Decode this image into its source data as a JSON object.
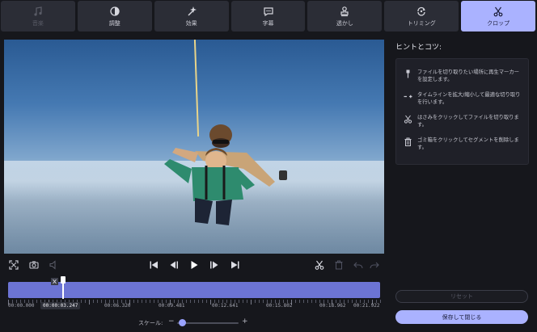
{
  "tabs": [
    {
      "label": "音楽",
      "icon": "music-note-icon",
      "state": "disabled"
    },
    {
      "label": "調整",
      "icon": "adjust-icon",
      "state": "normal"
    },
    {
      "label": "効果",
      "icon": "magic-wand-icon",
      "state": "normal"
    },
    {
      "label": "字幕",
      "icon": "speech-bubble-icon",
      "state": "normal"
    },
    {
      "label": "透かし",
      "icon": "stamp-icon",
      "state": "normal"
    },
    {
      "label": "トリミング",
      "icon": "rotate-icon",
      "state": "normal"
    },
    {
      "label": "クロップ",
      "icon": "scissors-icon",
      "state": "active"
    }
  ],
  "hints": {
    "title": "ヒントとコツ:",
    "items": [
      {
        "icon": "marker-pin-icon",
        "text": "ファイルを切り取りたい場所に再生マーカーを設定します。"
      },
      {
        "icon": "zoom-arrows-icon",
        "text": "タイムラインを拡大/縮小して最適な切り取りを行います。"
      },
      {
        "icon": "scissors-icon",
        "text": "はさみをクリックしてファイルを切り取ります。"
      },
      {
        "icon": "trash-icon",
        "text": "ゴミ箱をクリックしてセグメントを削除します。"
      }
    ]
  },
  "player": {
    "left_tools": [
      "fullscreen-icon",
      "camera-icon",
      "volume-icon"
    ],
    "transport": [
      "skip-start-icon",
      "prev-frame-icon",
      "play-icon",
      "next-frame-icon",
      "skip-end-icon"
    ],
    "edit_tools": [
      "scissors-icon",
      "trash-icon",
      "undo-icon",
      "redo-icon"
    ]
  },
  "timeline": {
    "current_time": "00:00:03.247",
    "labels": [
      "00:00.000",
      "00:06.320",
      "00:09.481",
      "00:12.641",
      "00:15.802",
      "00:18.962",
      "00:21.922"
    ],
    "playhead_fraction": 0.148
  },
  "scale": {
    "label": "スケール:",
    "minus": "−",
    "plus": "+",
    "value_fraction": 0.05
  },
  "buttons": {
    "reset": "リセット",
    "save_close": "保存して閉じる"
  },
  "colors": {
    "accent": "#aab2ff",
    "timeline": "#6c74d4",
    "background": "#16171c"
  }
}
